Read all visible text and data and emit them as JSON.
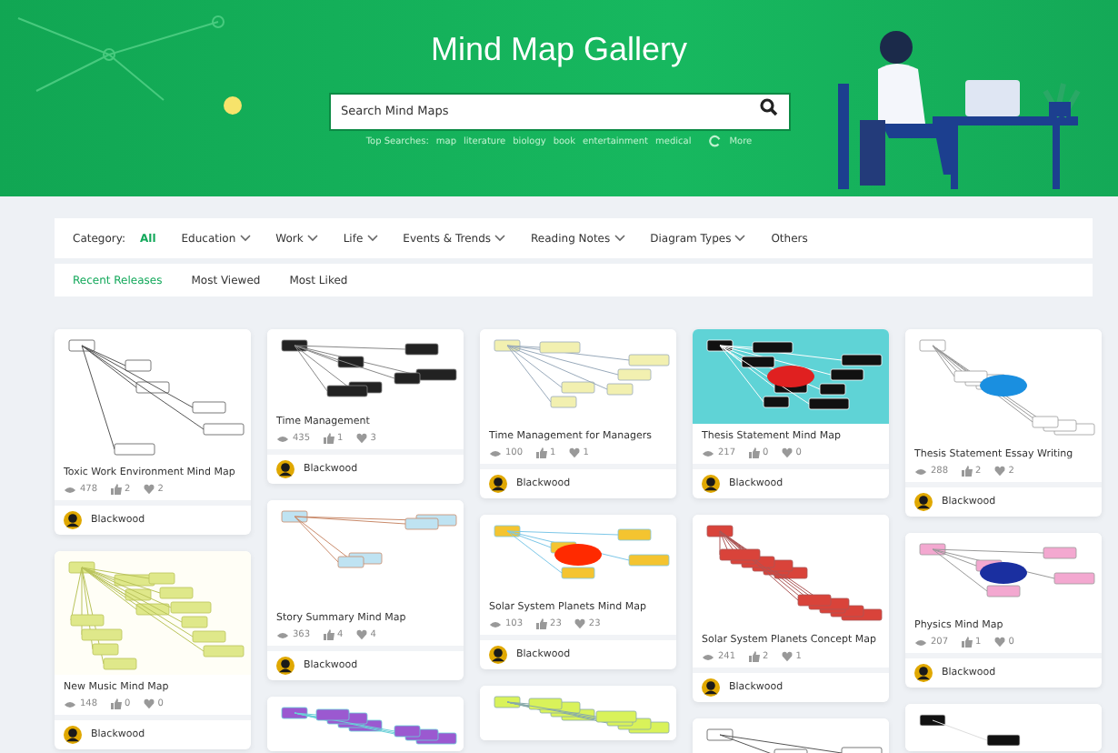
{
  "header": {
    "title": "Mind Map Gallery",
    "search": {
      "placeholder": "Search Mind Maps"
    },
    "top_searches": {
      "label": "Top Searches:",
      "terms": [
        "map",
        "literature",
        "biology",
        "book",
        "entertainment",
        "medical"
      ],
      "more": "More"
    }
  },
  "categories": {
    "label": "Category:",
    "items": [
      {
        "label": "All",
        "selected": true,
        "has_menu": false
      },
      {
        "label": "Education",
        "selected": false,
        "has_menu": true
      },
      {
        "label": "Work",
        "selected": false,
        "has_menu": true
      },
      {
        "label": "Life",
        "selected": false,
        "has_menu": true
      },
      {
        "label": "Events & Trends",
        "selected": false,
        "has_menu": true
      },
      {
        "label": "Reading Notes",
        "selected": false,
        "has_menu": true
      },
      {
        "label": "Diagram Types",
        "selected": false,
        "has_menu": true
      },
      {
        "label": "Others",
        "selected": false,
        "has_menu": false
      }
    ]
  },
  "sort_tabs": [
    {
      "label": "Recent Releases",
      "selected": true
    },
    {
      "label": "Most Viewed",
      "selected": false
    },
    {
      "label": "Most Liked",
      "selected": false
    }
  ],
  "columns": [
    [
      {
        "kind": "flowchart",
        "title": "Toxic Work Environment Mind Map",
        "views": "478",
        "likes": "2",
        "favorites": "2",
        "author": "Blackwood"
      },
      {
        "kind": "bubbles",
        "title": "New Music Mind Map",
        "views": "148",
        "likes": "0",
        "favorites": "0",
        "author": "Blackwood"
      }
    ],
    [
      {
        "kind": "list",
        "title": "Time Management",
        "views": "435",
        "likes": "1",
        "favorites": "3",
        "author": "Blackwood"
      },
      {
        "kind": "tree",
        "title": "Story Summary Mind Map",
        "views": "363",
        "likes": "4",
        "favorites": "4",
        "author": "Blackwood"
      },
      {
        "kind": "purple"
      }
    ],
    [
      {
        "kind": "yellow",
        "title": "Time Management for Managers",
        "views": "100",
        "likes": "1",
        "favorites": "1",
        "author": "Blackwood"
      },
      {
        "kind": "cloud",
        "title": "Solar System Planets Mind Map",
        "views": "103",
        "likes": "23",
        "favorites": "23",
        "author": "Blackwood"
      },
      {
        "kind": "lime"
      }
    ],
    [
      {
        "kind": "teal",
        "title": "Thesis Statement Mind Map",
        "views": "217",
        "likes": "0",
        "favorites": "0",
        "author": "Blackwood"
      },
      {
        "kind": "concept",
        "title": "Solar System Planets Concept Map",
        "views": "241",
        "likes": "2",
        "favorites": "1",
        "author": "Blackwood"
      },
      {
        "kind": "outline"
      }
    ],
    [
      {
        "kind": "radial",
        "title": "Thesis Statement Essay Writing",
        "views": "288",
        "likes": "2",
        "favorites": "2",
        "author": "Blackwood"
      },
      {
        "kind": "physics",
        "title": "Physics Mind Map",
        "views": "207",
        "likes": "1",
        "favorites": "0",
        "author": "Blackwood"
      },
      {
        "kind": "dark"
      }
    ]
  ]
}
